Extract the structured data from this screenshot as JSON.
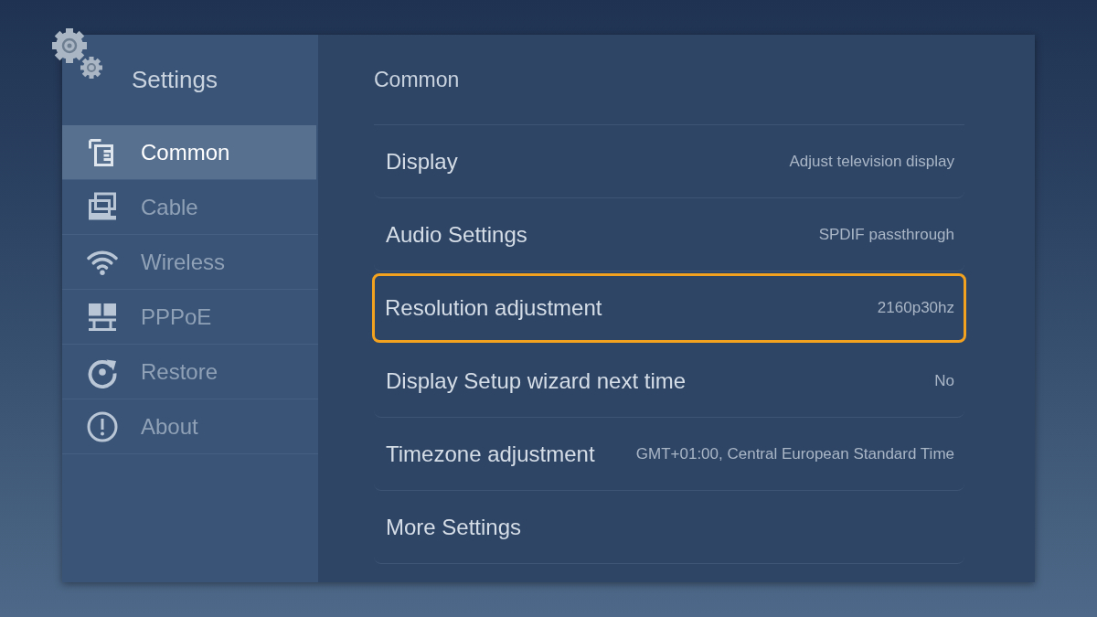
{
  "sidebar": {
    "title": "Settings",
    "items": [
      {
        "label": "Common",
        "selected": true
      },
      {
        "label": "Cable",
        "selected": false
      },
      {
        "label": "Wireless",
        "selected": false
      },
      {
        "label": "PPPoE",
        "selected": false
      },
      {
        "label": "Restore",
        "selected": false
      },
      {
        "label": "About",
        "selected": false
      }
    ]
  },
  "content": {
    "title": "Common",
    "rows": [
      {
        "label": "Display",
        "value": "Adjust television display",
        "focused": false
      },
      {
        "label": "Audio Settings",
        "value": "SPDIF passthrough",
        "focused": false
      },
      {
        "label": "Resolution adjustment",
        "value": "2160p30hz",
        "focused": true
      },
      {
        "label": "Display Setup wizard next time",
        "value": "No",
        "focused": false
      },
      {
        "label": "Timezone adjustment",
        "value": "GMT+01:00, Central European Standard Time",
        "focused": false
      },
      {
        "label": "More Settings",
        "focused": false
      }
    ]
  }
}
